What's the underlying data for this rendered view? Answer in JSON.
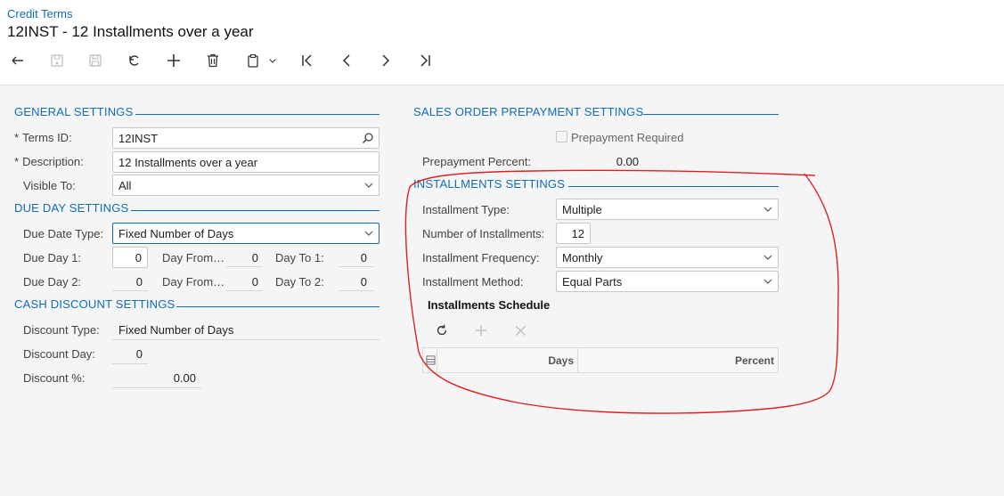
{
  "header": {
    "breadcrumb": "Credit Terms",
    "title": "12INST - 12 Installments over a year",
    "toolbar_icons": [
      "back-icon",
      "save-close-icon",
      "save-icon",
      "undo-icon",
      "add-icon",
      "delete-icon",
      "copy-paste-icon",
      "first-record-icon",
      "previous-record-icon",
      "next-record-icon",
      "last-record-icon"
    ]
  },
  "general": {
    "title": "GENERAL SETTINGS",
    "terms_id_label": "Terms ID:",
    "terms_id_value": "12INST",
    "description_label": "Description:",
    "description_value": "12 Installments over a year",
    "visible_to_label": "Visible To:",
    "visible_to_value": "All",
    "required_marker": "*"
  },
  "due_day": {
    "title": "DUE DAY SETTINGS",
    "due_date_type_label": "Due Date Type:",
    "due_date_type_value": "Fixed Number of Days",
    "due_day1_label": "Due Day 1:",
    "due_day1_value": "0",
    "day_from1_label": "Day From…",
    "day_from1_value": "0",
    "day_to1_label": "Day To 1:",
    "day_to1_value": "0",
    "due_day2_label": "Due Day 2:",
    "due_day2_value": "0",
    "day_from2_label": "Day From…",
    "day_from2_value": "0",
    "day_to2_label": "Day To 2:",
    "day_to2_value": "0"
  },
  "cash_discount": {
    "title": "CASH DISCOUNT SETTINGS",
    "discount_type_label": "Discount Type:",
    "discount_type_value": "Fixed Number of Days",
    "discount_day_label": "Discount Day:",
    "discount_day_value": "0",
    "discount_pct_label": "Discount %:",
    "discount_pct_value": "0.00"
  },
  "prepayment": {
    "title": "SALES ORDER PREPAYMENT SETTINGS",
    "required_label": "Prepayment Required",
    "percent_label": "Prepayment Percent:",
    "percent_value": "0.00"
  },
  "installments": {
    "title": "INSTALLMENTS SETTINGS",
    "type_label": "Installment Type:",
    "type_value": "Multiple",
    "number_label": "Number of Installments:",
    "number_value": "12",
    "frequency_label": "Installment Frequency:",
    "frequency_value": "Monthly",
    "method_label": "Installment Method:",
    "method_value": "Equal Parts",
    "schedule_title": "Installments Schedule",
    "columns": [
      "Days",
      "Percent"
    ]
  },
  "colors": {
    "accent": "#0f6cbd",
    "annotation": "#e02020"
  }
}
